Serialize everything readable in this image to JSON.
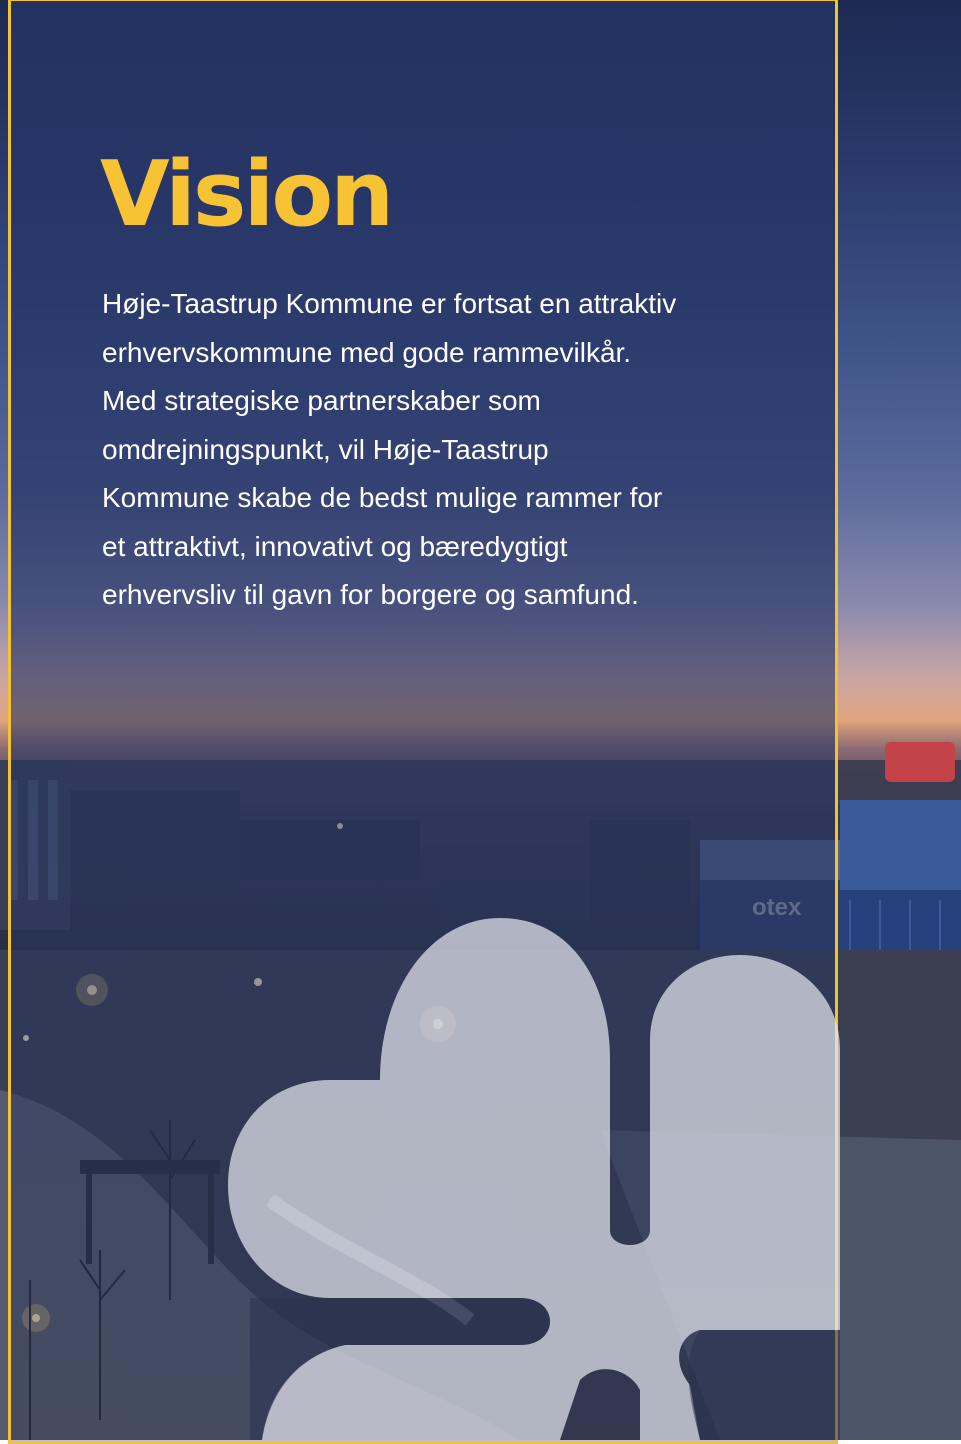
{
  "colors": {
    "accent": "#f3c22f",
    "title": "#f7c335",
    "text": "#ffffff",
    "panel_overlay": "#263464"
  },
  "content": {
    "title": "Vision",
    "lines": [
      "Høje-Taastrup Kommune er fortsat en attraktiv",
      "erhvervskommune med gode rammevilkår.",
      "Med strategiske partnerskaber som",
      "omdrejningspunkt, vil Høje-Taastrup",
      "Kommune skabe de bedst mulige rammer for",
      "et attraktivt, innovativt og bæredygtigt",
      "erhvervsliv til gavn for borgere og samfund."
    ]
  },
  "background": {
    "sign_text": "otex"
  },
  "icons": {
    "logo": "kommune-logo-icon"
  }
}
